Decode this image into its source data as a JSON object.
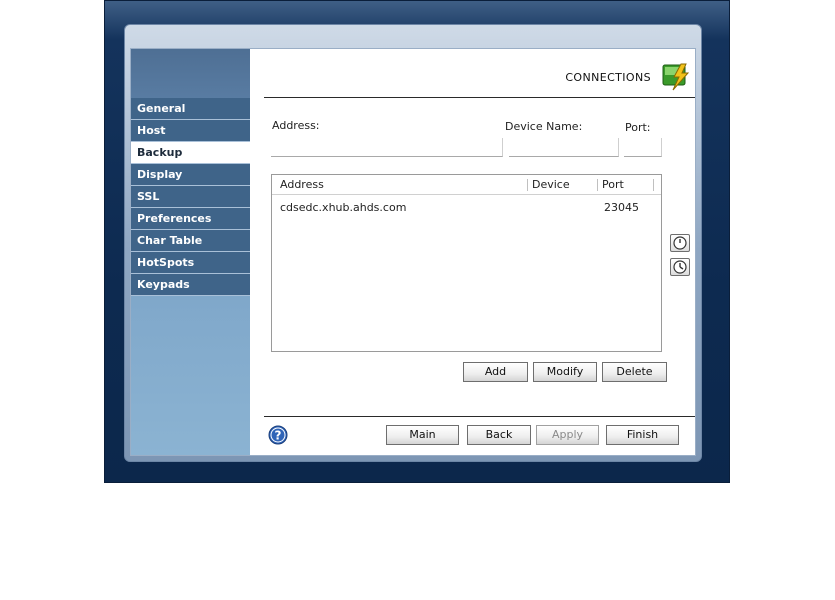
{
  "sidebar": {
    "items": [
      {
        "label": "General",
        "active": false
      },
      {
        "label": "Host",
        "active": false
      },
      {
        "label": "Backup",
        "active": true
      },
      {
        "label": "Display",
        "active": false
      },
      {
        "label": "SSL",
        "active": false
      },
      {
        "label": "Preferences",
        "active": false
      },
      {
        "label": "Char Table",
        "active": false
      },
      {
        "label": "HotSpots",
        "active": false
      },
      {
        "label": "Keypads",
        "active": false
      }
    ]
  },
  "header": {
    "title": "CONNECTIONS",
    "icon": "lightning-connection-icon"
  },
  "form": {
    "address_label": "Address:",
    "address_value": "",
    "device_label": "Device Name:",
    "device_value": "",
    "port_label": "Port:",
    "port_value": ""
  },
  "table": {
    "columns": [
      "Address",
      "Device",
      "Port"
    ],
    "rows": [
      {
        "address": "cdsedc.xhub.ahds.com",
        "device": "",
        "port": "23045"
      }
    ]
  },
  "list_buttons": {
    "add": "Add",
    "modify": "Modify",
    "delete": "Delete"
  },
  "footer": {
    "main": "Main",
    "back": "Back",
    "apply": "Apply",
    "finish": "Finish"
  },
  "colors": {
    "outer_bg": "#0d2a50",
    "nav_bg": "#3f6489",
    "nav_active_bg": "#ffffff"
  }
}
